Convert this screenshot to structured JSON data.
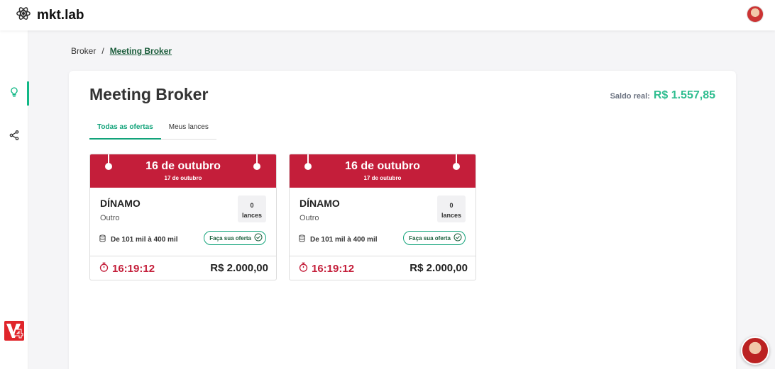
{
  "app": {
    "name": "mkt.lab"
  },
  "breadcrumb": {
    "root": "Broker",
    "separator": "/",
    "current": "Meeting Broker"
  },
  "page": {
    "title": "Meeting Broker",
    "balance_label": "Saldo real:",
    "balance_value": "R$ 1.557,85"
  },
  "tabs": [
    {
      "label": "Todas as ofertas",
      "active": true
    },
    {
      "label": "Meus lances",
      "active": false
    }
  ],
  "cards": [
    {
      "date": "16 de outubro",
      "subdate": "17 de outubro",
      "name": "DÍNAMO",
      "category": "Outro",
      "bids_count": "0",
      "bids_label": "lances",
      "range": "De 101 mil à 400 mil",
      "offer_button": "Faça sua oferta",
      "timer": "16:19:12",
      "price": "R$ 2.000,00"
    },
    {
      "date": "16 de outubro",
      "subdate": "17 de outubro",
      "name": "DÍNAMO",
      "category": "Outro",
      "bids_count": "0",
      "bids_label": "lances",
      "range": "De 101 mil à 400 mil",
      "offer_button": "Faça sua oferta",
      "timer": "16:19:12",
      "price": "R$ 2.000,00"
    }
  ],
  "colors": {
    "accent": "#12a37a",
    "card_header": "#c41e3a",
    "balance": "#2ebd8f"
  },
  "icons": {
    "logo": "atom-icon",
    "sidebar": [
      "lightbulb-icon",
      "share-icon"
    ],
    "range": "database-icon",
    "offer": "check-circle-icon",
    "timer": "stopwatch-icon"
  }
}
